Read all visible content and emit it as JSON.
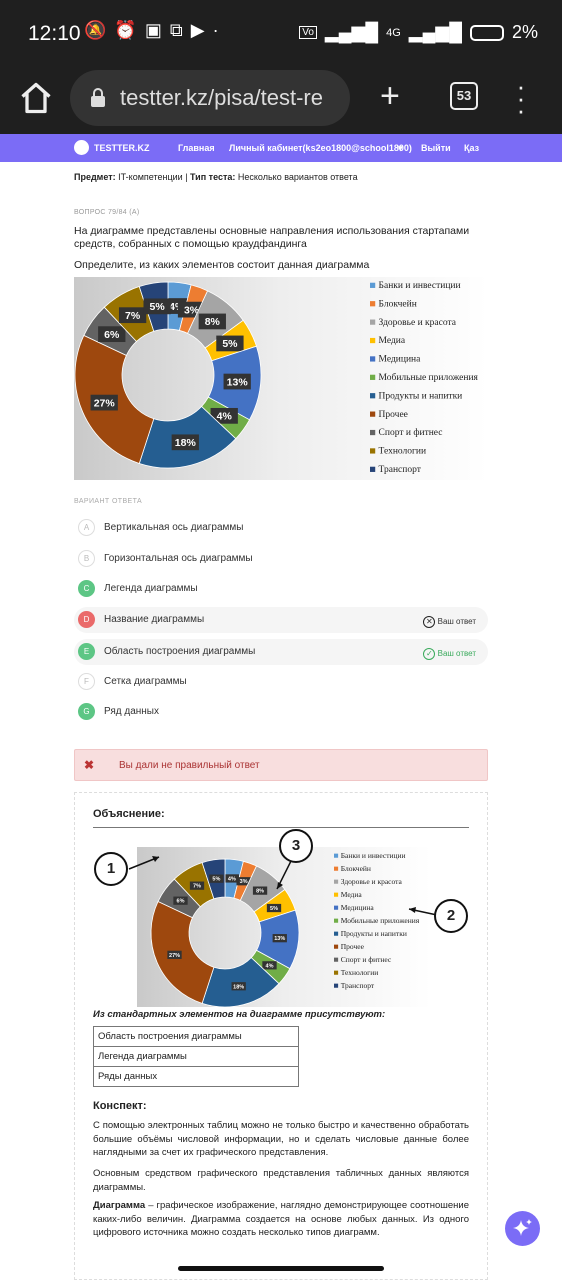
{
  "status_bar": {
    "time": "12:10",
    "network": "4G",
    "battery": "2%"
  },
  "browser": {
    "url": "testter.kz/pisa/test-re",
    "tab_count": "53"
  },
  "nav": {
    "logo_text": "TESTTER.KZ",
    "home": "Главная",
    "cabinet": "Личный кабинет(ks2eo1800@school1800)",
    "logout": "Выйти",
    "lang": "Қаз"
  },
  "question": {
    "subject_label": "Предмет:",
    "subject_value": "IT-компетенции",
    "type_label": "Тип теста:",
    "type_value": "Несколько вариантов ответа",
    "number": "ВОПРОС 79/84 (А)",
    "text": "На диаграмме представлены основные направления использования стартапами средств, собранных с помощью краудфандинга",
    "prompt": "Определите, из каких элементов состоит данная диаграмма"
  },
  "chart_data": {
    "type": "pie",
    "categories": [
      "Банки и инвестиции",
      "Блокчейн",
      "Здоровье и красота",
      "Медиа",
      "Медицина",
      "Мобильные приложения",
      "Продукты и напитки",
      "Прочее",
      "Спорт и фитнес",
      "Технологии",
      "Транспорт"
    ],
    "values": [
      4,
      3,
      8,
      5,
      13,
      4,
      18,
      27,
      6,
      7,
      5
    ],
    "labels": [
      "4%",
      "3%",
      "8%",
      "5%",
      "13%",
      "4%",
      "18%",
      "27%",
      "6%",
      "7%",
      "5%"
    ],
    "colors": [
      "#5b9bd5",
      "#ed7d31",
      "#a5a5a5",
      "#ffc000",
      "#4472c4",
      "#70ad47",
      "#255e91",
      "#9e480e",
      "#636363",
      "#997300",
      "#264478"
    ],
    "legend_position": "right"
  },
  "answers": {
    "heading": "ВАРИАНТ ОТВЕТА",
    "your_answer": "Ваш ответ",
    "options": [
      {
        "letter": "A",
        "text": "Вертикальная ось диаграммы"
      },
      {
        "letter": "B",
        "text": "Горизонтальная ось диаграммы"
      },
      {
        "letter": "C",
        "text": "Легенда диаграммы"
      },
      {
        "letter": "D",
        "text": "Название диаграммы"
      },
      {
        "letter": "E",
        "text": "Область построения диаграммы"
      },
      {
        "letter": "F",
        "text": "Сетка диаграммы"
      },
      {
        "letter": "G",
        "text": "Ряд данных"
      }
    ]
  },
  "result": {
    "message": "Вы дали не правильный ответ"
  },
  "explanation": {
    "heading": "Объяснение:",
    "callouts": [
      "1",
      "2",
      "3"
    ],
    "std_heading": "Из стандартных элементов на диаграмме присутствуют:",
    "std_items": [
      "Область построения диаграммы",
      "Легенда диаграммы",
      "Ряды данных"
    ],
    "konspekt_heading": "Конспект:",
    "para1": "С помощью электронных таблиц можно не только быстро и качественно обработать большие объёмы числовой информации, но и сделать числовые данные более наглядными за счет их графического представления.",
    "para2": "Основным средством графического представления табличных данных являются диаграммы.",
    "para3_term": "Диаграмма",
    "para3_rest": " – графическое изображение, наглядно демонстрирующее соотношение каких-либо величин. Диаграмма создается на основе любых данных. Из одного цифрового источника можно создать несколько типов диаграмм."
  }
}
